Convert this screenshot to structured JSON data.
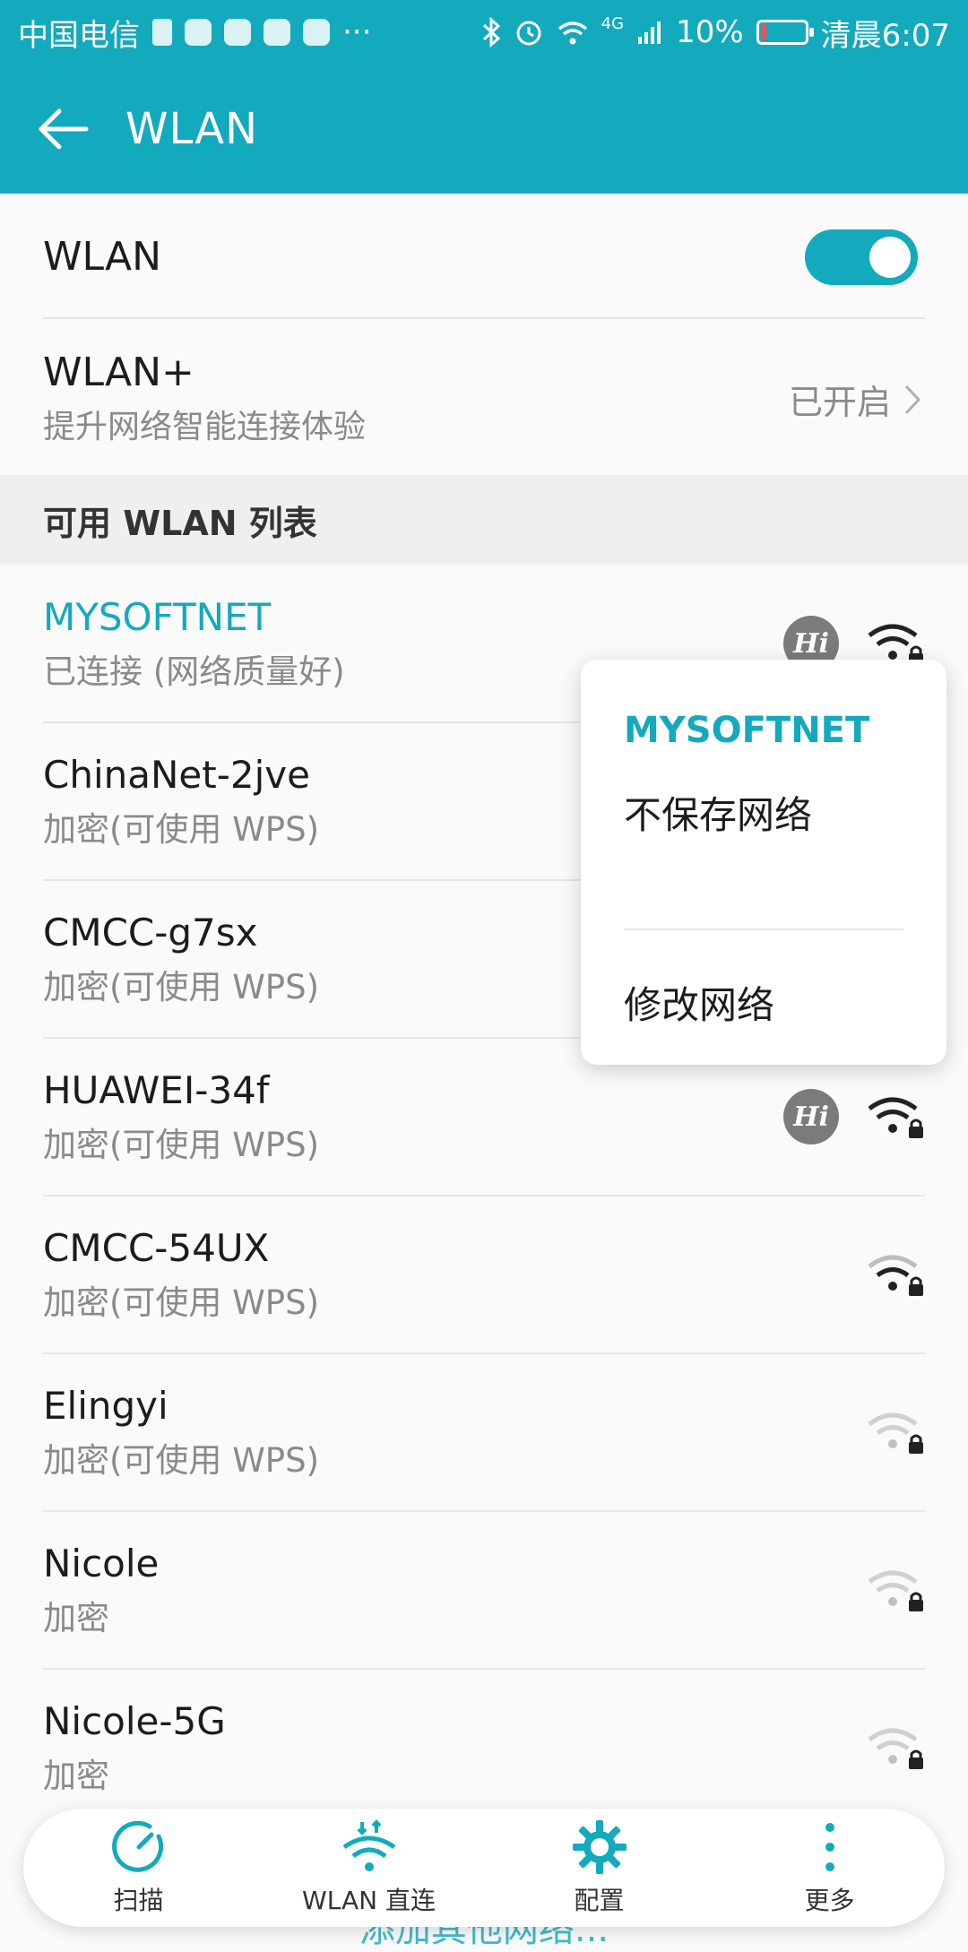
{
  "colors": {
    "accent": "#13aabd",
    "battery_low": "#ff4b4b"
  },
  "status_bar": {
    "carrier": "中国电信",
    "network_type": "4G",
    "battery": "10%",
    "time": "清晨6:07",
    "more": "···"
  },
  "app_bar": {
    "title": "WLAN"
  },
  "wlan_toggle": {
    "label": "WLAN",
    "on": true
  },
  "wlan_plus": {
    "title": "WLAN+",
    "subtitle": "提升网络智能连接体验",
    "status": "已开启"
  },
  "section_header": "可用 WLAN 列表",
  "networks": [
    {
      "name": "MYSOFTNET",
      "status": "已连接 (网络质量好)",
      "hi": true,
      "signal": "strong"
    },
    {
      "name": "ChinaNet-2jve",
      "status": "加密(可使用 WPS)",
      "hi": false,
      "signal": "strong"
    },
    {
      "name": "CMCC-g7sx",
      "status": "加密(可使用 WPS)",
      "hi": false,
      "signal": "strong"
    },
    {
      "name": "HUAWEI-34f",
      "status": "加密(可使用 WPS)",
      "hi": true,
      "signal": "strong"
    },
    {
      "name": "CMCC-54UX",
      "status": "加密(可使用 WPS)",
      "hi": false,
      "signal": "medium"
    },
    {
      "name": "Elingyi",
      "status": "加密(可使用 WPS)",
      "hi": false,
      "signal": "weak"
    },
    {
      "name": "Nicole",
      "status": "加密",
      "hi": false,
      "signal": "weak"
    },
    {
      "name": "Nicole-5G",
      "status": "加密",
      "hi": false,
      "signal": "weak"
    }
  ],
  "popup": {
    "title": "MYSOFTNET",
    "forget": "不保存网络",
    "modify": "修改网络"
  },
  "bottom_bar": {
    "scan": "扫描",
    "direct": "WLAN 直连",
    "config": "配置",
    "more": "更多"
  },
  "add_network_peek": "添加其他网络..."
}
